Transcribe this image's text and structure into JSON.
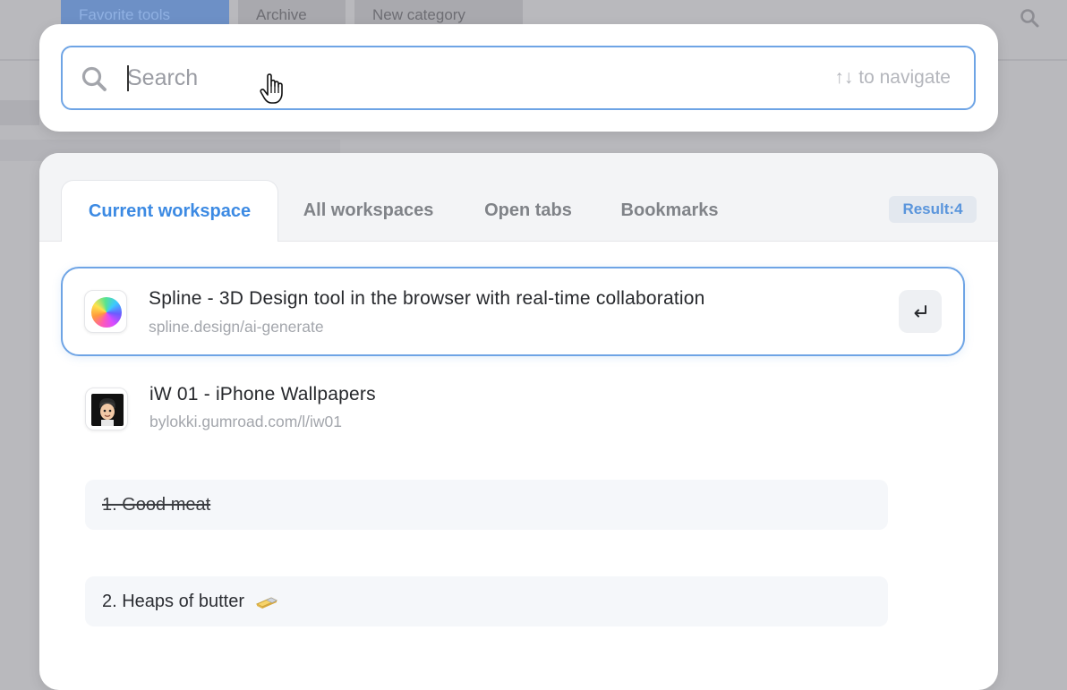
{
  "background": {
    "tabs": [
      "Favorite tools",
      "Archive",
      "New category"
    ]
  },
  "search": {
    "placeholder": "Search",
    "value": "",
    "hint": "↑↓ to navigate"
  },
  "tabs": [
    {
      "label": "Current workspace",
      "active": true
    },
    {
      "label": "All workspaces",
      "active": false
    },
    {
      "label": "Open tabs",
      "active": false
    },
    {
      "label": "Bookmarks",
      "active": false
    }
  ],
  "result_count": "Result:4",
  "results": [
    {
      "title": "Spline - 3D Design tool in the browser with real-time collaboration",
      "url": "spline.design/ai-generate",
      "icon": "spline-orb-icon",
      "selected": true
    },
    {
      "title": "iW 01 - iPhone Wallpapers",
      "url": "bylokki.gumroad.com/l/iw01",
      "icon": "memoji-avatar-icon",
      "selected": false
    }
  ],
  "notes": [
    {
      "text": "1. Good meat",
      "done": true
    },
    {
      "text": "2. Heaps of butter",
      "done": false,
      "emoji": "butter-icon"
    }
  ],
  "colors": {
    "accent": "#3c8ae3",
    "focus_border": "#6ea4e5"
  }
}
